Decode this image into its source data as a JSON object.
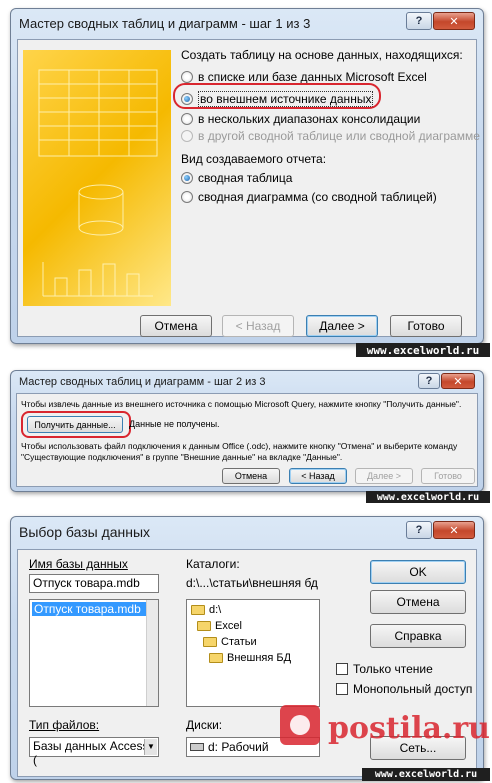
{
  "wizard1": {
    "title": "Мастер сводных таблиц и диаграмм - шаг 1 из 3",
    "help": "?",
    "close": "✕",
    "source_heading": "Создать таблицу на основе данных, находящихся:",
    "source_options": [
      "в списке или базе данных Microsoft Excel",
      "во внешнем источнике данных",
      "в нескольких диапазонах консолидации",
      "в другой сводной таблице или сводной диаграмме"
    ],
    "report_heading": "Вид создаваемого отчета:",
    "report_options": [
      "сводная таблица",
      "сводная диаграмма (со сводной таблицей)"
    ],
    "buttons": {
      "cancel": "Отмена",
      "back": "< Назад",
      "next": "Далее >",
      "finish": "Готово"
    }
  },
  "wizard2": {
    "title": "Мастер сводных таблиц и диаграмм - шаг 2 из 3",
    "help": "?",
    "close": "✕",
    "instruction": "Чтобы извлечь данные из внешнего источника с помощью Microsoft Query, нажмите кнопку \"Получить данные\".",
    "get_data": "Получить данные...",
    "status": "Данные не получены.",
    "note_line1": "Чтобы использовать файл подключения к данным Office (.odc), нажмите кнопку \"Отмена\" и выберите команду",
    "note_line2": "\"Существующие подключения\" в группе \"Внешние данные\" на вкладке \"Данные\".",
    "buttons": {
      "cancel": "Отмена",
      "back": "< Назад",
      "next": "Далее >",
      "finish": "Готово"
    }
  },
  "dbdialog": {
    "title": "Выбор базы данных",
    "help": "?",
    "close": "✕",
    "db_name_label": "Имя базы данных",
    "db_name_value": "Отпуск товара.mdb",
    "db_list": [
      "Отпуск товара.mdb"
    ],
    "dir_label": "Каталоги:",
    "dir_path": "d:\\...\\статьи\\внешняя бд",
    "folders": [
      "d:\\",
      "Excel",
      "Статьи",
      "Внешняя БД"
    ],
    "ok": "OK",
    "cancel": "Отмена",
    "help_btn": "Справка",
    "read_only": "Только чтение",
    "exclusive": "Монопольный доступ",
    "file_type_label": "Тип файлов:",
    "file_type_value": "Базы данных Access (",
    "drives_label": "Диски:",
    "drive_value": "d: Рабочий",
    "network_btn": "Сеть..."
  },
  "watermark": "www.excelworld.ru",
  "site_logo": "postila.ru"
}
